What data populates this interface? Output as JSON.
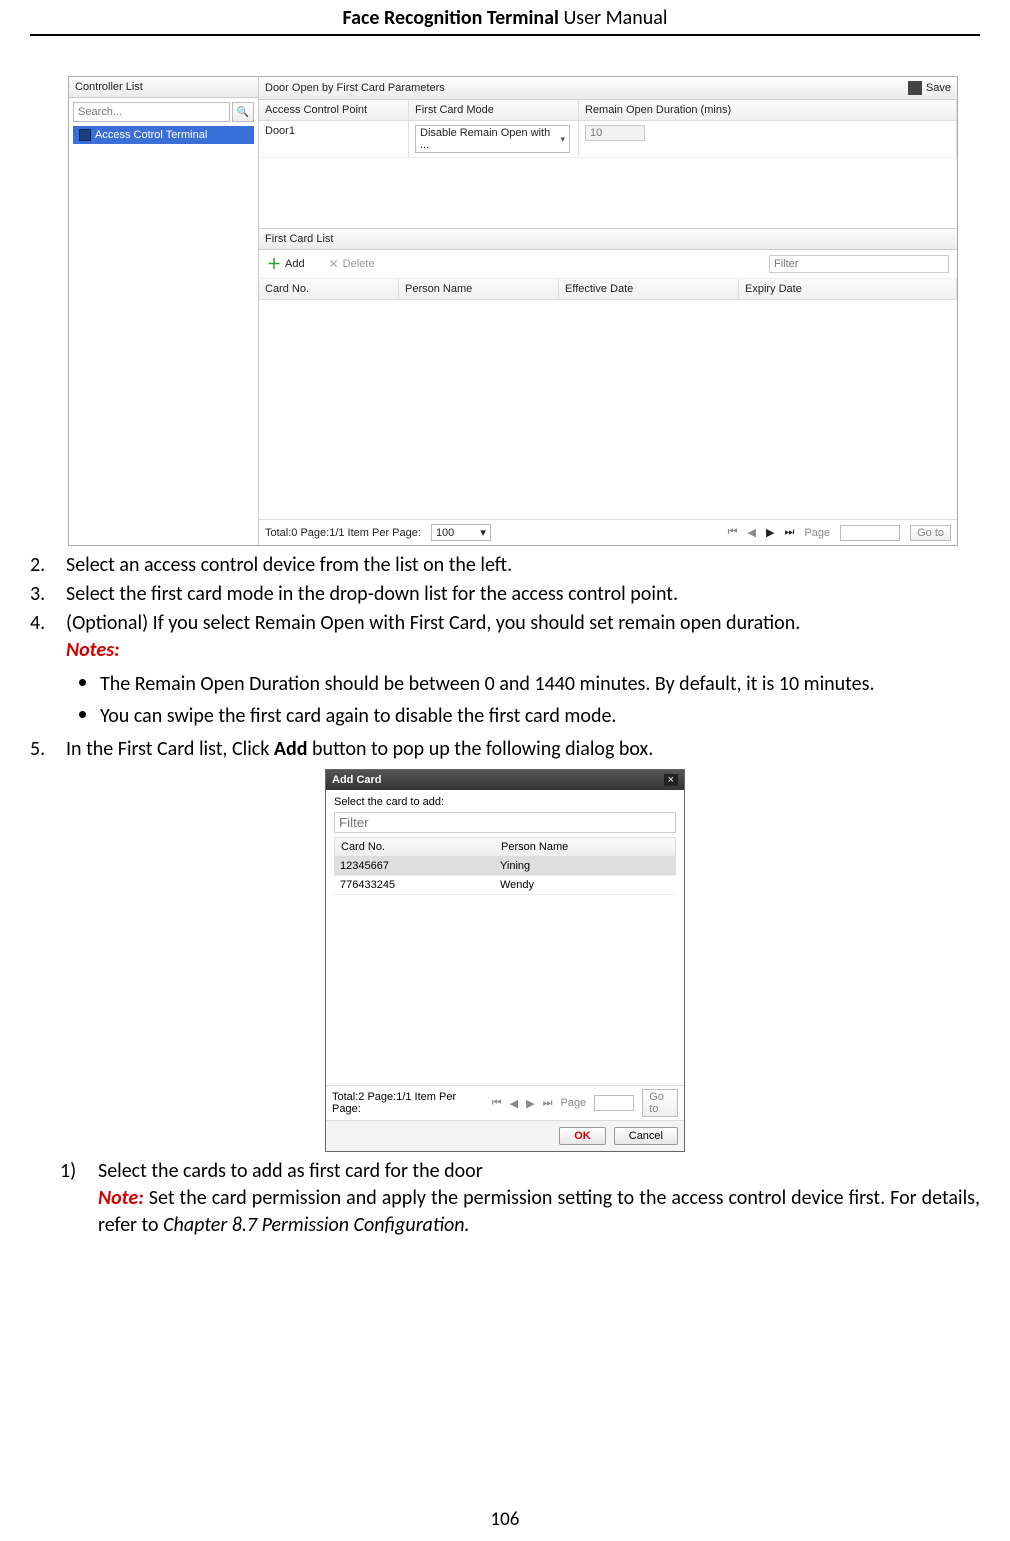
{
  "header": {
    "title_bold": "Face Recognition Terminal",
    "title_rest": "  User Manual"
  },
  "page_number": "106",
  "shot1": {
    "controller_list": "Controller List",
    "search_placeholder": "Search...",
    "tree_item": "Access Cotrol Terminal",
    "panel_title": "Door Open by First Card Parameters",
    "save": "Save",
    "cols": {
      "acp": "Access Control Point",
      "fcm": "First Card Mode",
      "rod": "Remain Open Duration (mins)"
    },
    "row": {
      "door": "Door1",
      "mode": "Disable Remain Open with ...",
      "dur": "10"
    },
    "fc_list": "First Card List",
    "add": "Add",
    "delete": "Delete",
    "filter": "Filter",
    "fc_cols": {
      "cn": "Card No.",
      "pn": "Person Name",
      "ed": "Effective Date",
      "xd": "Expiry Date"
    },
    "foot_total": "Total:0   Page:1/1   Item Per Page:",
    "ipp": "100",
    "page_label": "Page",
    "goto": "Go to"
  },
  "instr": {
    "i2": "Select an access control device from the list on the left.",
    "i3": "Select the first card mode in the drop-down list for the access control point.",
    "i4": "(Optional) If you select Remain Open with First Card, you should set remain open duration.",
    "notes": "Notes:",
    "b1": "The Remain Open Duration should be between 0 and 1440 minutes. By default, it is 10 minutes.",
    "b2": "You can swipe the first card again to disable the first card mode.",
    "i5_a": "In the First Card list, Click ",
    "i5_add": "Add",
    "i5_b": " button to pop up the following dialog box."
  },
  "dialog": {
    "title": "Add Card",
    "prompt": "Select the card to add:",
    "filter": "Filter",
    "cols": {
      "cn": "Card No.",
      "pn": "Person Name"
    },
    "rows": [
      {
        "cn": "12345667",
        "pn": "Yining"
      },
      {
        "cn": "776433245",
        "pn": "Wendy"
      }
    ],
    "foot": "Total:2   Page:1/1   Item Per Page:",
    "page_label": "Page",
    "goto": "Go to",
    "ok": "OK",
    "cancel": "Cancel"
  },
  "nested": {
    "n1": "Select the cards to add as first card for the door",
    "note": "Note:",
    "rest_a": " Set the card permission and apply the permission setting to the access control device first. For details, refer to ",
    "chapter": "Chapter 8.7 Permission Configuration.",
    "tail": ""
  }
}
